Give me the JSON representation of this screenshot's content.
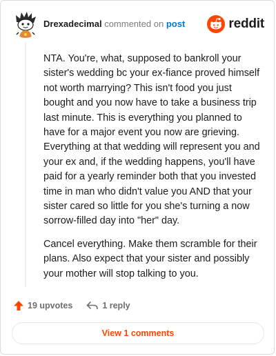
{
  "header": {
    "username": "Drexadecimal",
    "action_text": "commented on",
    "post_link": "post",
    "brand": "reddit",
    "brand_color": "#ff4500",
    "avatar_icon": "snoo-avatar-icon"
  },
  "comment": {
    "paragraphs": [
      "NTA. You're, what, supposed to bankroll your sister's wedding bc your ex-fiance proved himself not worth marrying? This isn't food you just bought and you now have to take a business trip last minute. This is everything you planned to have for a major event you now are grieving. Everything at that wedding will represent you and your ex and, if the wedding happens, you'll have paid for a yearly reminder both that you invested time in man who didn't value you AND that your sister cared so little for you she's turning a now sorrow-filled day into \"her\" day.",
      "Cancel everything. Make them scramble for their plans. Also expect that your sister and possibly your mother will stop talking to you."
    ]
  },
  "actions": {
    "upvotes": "19 upvotes",
    "replies": "1 reply",
    "upvote_icon": "upvote-arrow-icon",
    "reply_icon": "reply-arrow-icon",
    "upvote_color": "#ff4500"
  },
  "footer": {
    "view_comments": "View 1 comments"
  }
}
